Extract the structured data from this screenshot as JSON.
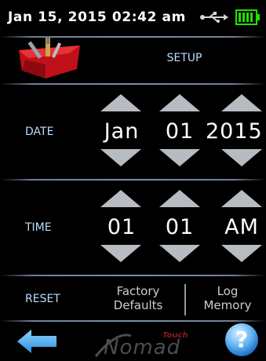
{
  "status": {
    "datetime": "Jan 15, 2015  02:42 am",
    "usb_icon": "usb-icon",
    "battery_icon": "battery-full-icon",
    "battery_color": "#22e000"
  },
  "header": {
    "title": "SETUP",
    "icon": "toolbox-icon"
  },
  "date": {
    "label": "DATE",
    "month": "Jan",
    "day": "01",
    "year": "2015"
  },
  "time": {
    "label": "TIME",
    "hour": "01",
    "minute": "01",
    "ampm": "AM"
  },
  "reset": {
    "label": "RESET",
    "factory_line1": "Factory",
    "factory_line2": "Defaults",
    "log_line1": "Log",
    "log_line2": "Memory"
  },
  "footer": {
    "back_icon": "back-arrow-icon",
    "logo_small": "Touch",
    "logo_main": "Nomad",
    "help_icon": "help-icon",
    "help_glyph": "?"
  },
  "colors": {
    "accent_label": "#b9dcff",
    "arrow_gray": "#b7bcc2"
  }
}
